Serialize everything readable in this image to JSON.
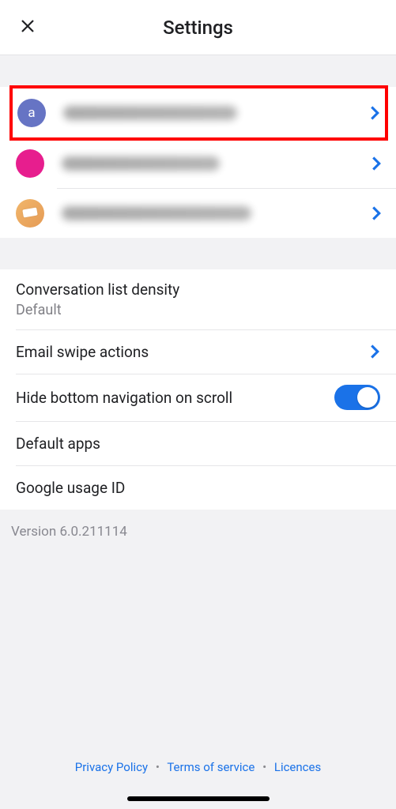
{
  "header": {
    "title": "Settings"
  },
  "accounts": [
    {
      "avatar_letter": "a",
      "avatar_color": "blue",
      "highlighted": true
    },
    {
      "avatar_letter": "",
      "avatar_color": "pink",
      "highlighted": false
    },
    {
      "avatar_letter": "",
      "avatar_color": "orange",
      "highlighted": false
    }
  ],
  "settings": {
    "density_label": "Conversation list density",
    "density_value": "Default",
    "swipe_label": "Email swipe actions",
    "hide_nav_label": "Hide bottom navigation on scroll",
    "hide_nav_on": true,
    "default_apps_label": "Default apps",
    "usage_id_label": "Google usage ID"
  },
  "version": "Version 6.0.211114",
  "footer": {
    "privacy": "Privacy Policy",
    "terms": "Terms of service",
    "licences": "Licences"
  }
}
